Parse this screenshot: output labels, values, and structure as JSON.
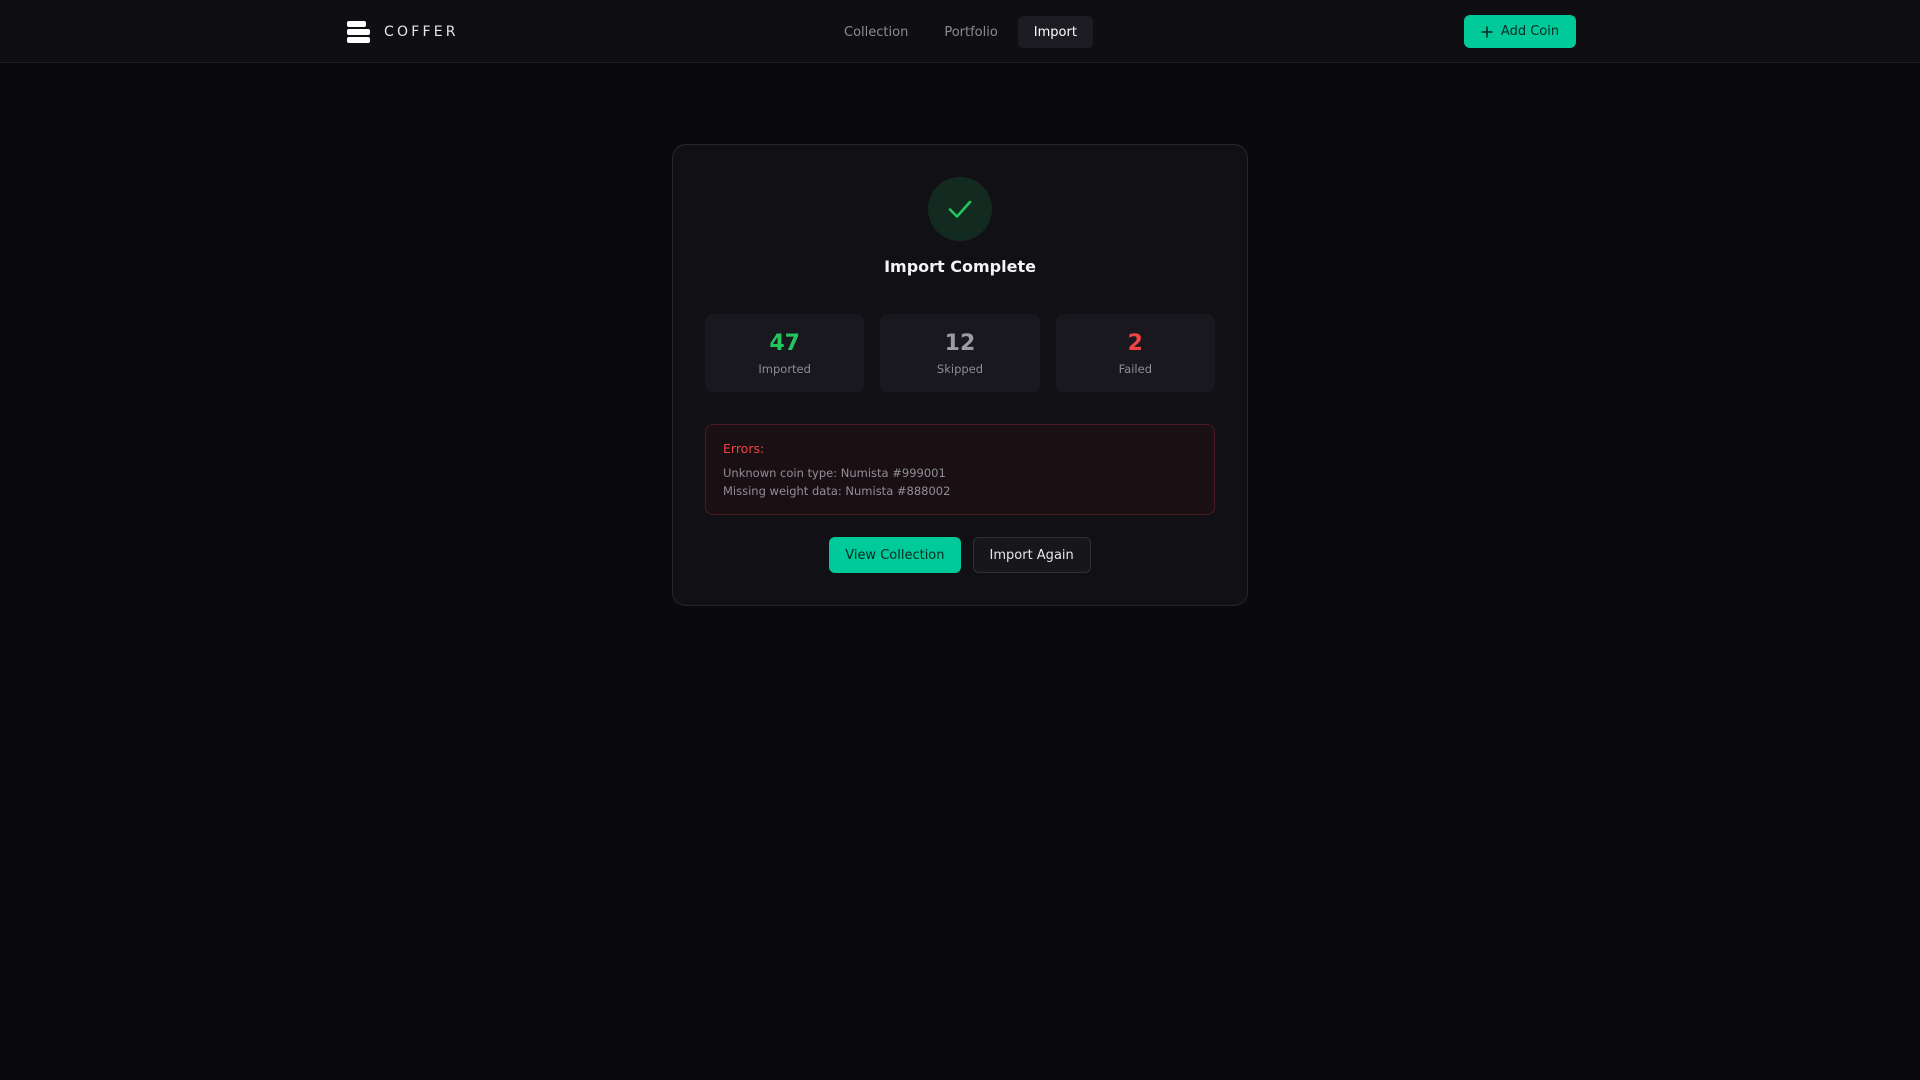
{
  "brand": {
    "name": "COFFER",
    "logo_icon": "coffer-logo-icon"
  },
  "nav": {
    "tabs": [
      {
        "label": "Collection",
        "active": false
      },
      {
        "label": "Portfolio",
        "active": false
      },
      {
        "label": "Import",
        "active": true
      }
    ]
  },
  "header": {
    "add_label": "Add Coin",
    "add_icon": "plus-icon"
  },
  "result": {
    "icon": "check-icon",
    "title": "Import Complete",
    "stats": [
      {
        "value": "47",
        "label": "Imported",
        "color": "#22c55e"
      },
      {
        "value": "12",
        "label": "Skipped",
        "color": "#9b9ba4"
      },
      {
        "value": "2",
        "label": "Failed",
        "color": "#ef4444"
      }
    ],
    "errors": {
      "title": "Errors:",
      "items": [
        "Unknown coin type: Numista #999001",
        "Missing weight data: Numista #888002"
      ]
    },
    "actions": {
      "primary_label": "View Collection",
      "secondary_label": "Import Again"
    }
  },
  "colors": {
    "accent": "#00c99a",
    "background": "#0a0a0e",
    "success": "#22c55e",
    "danger": "#ef4444"
  }
}
